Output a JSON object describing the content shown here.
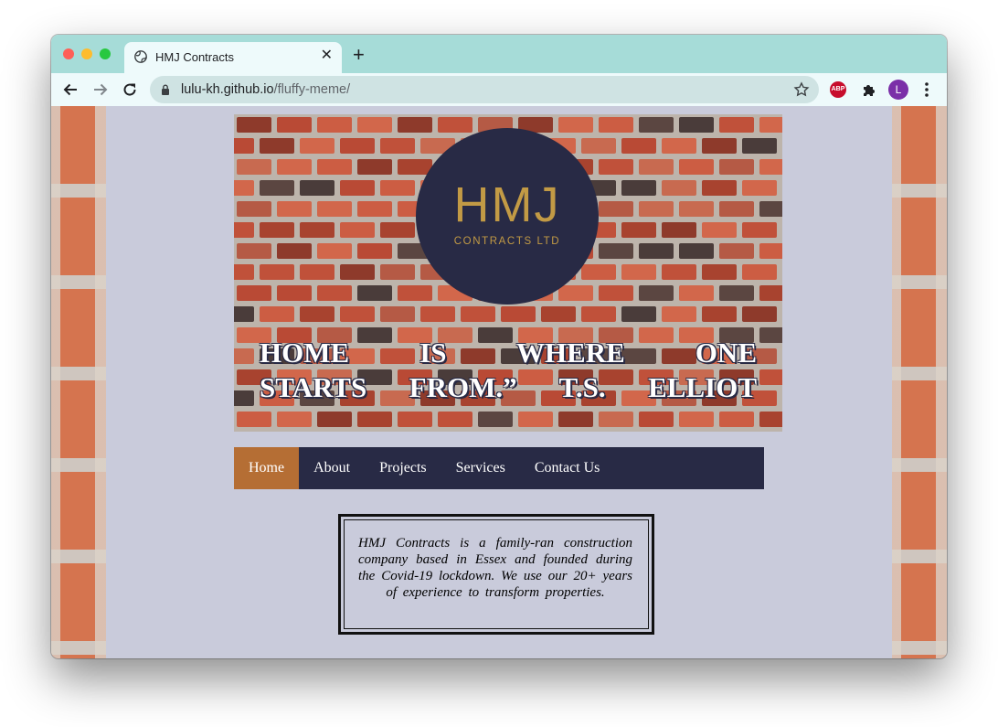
{
  "browser": {
    "tab_title": "HMJ Contracts",
    "url_host": "lulu-kh.github.io",
    "url_path": "/fluffy-meme/",
    "profile_initial": "L",
    "extension_abp": "ABP",
    "colors": {
      "tabstrip": "#a6dcd8",
      "toolbar": "#eefafb"
    }
  },
  "page": {
    "logo_main": "HMJ",
    "logo_sub": "CONTRACTS LTD",
    "quote_line1": "HOME IS WHERE ONE",
    "quote_line2": "STARTS FROM.” T.S. ELLIOT",
    "nav": [
      {
        "label": "Home",
        "active": true
      },
      {
        "label": "About",
        "active": false
      },
      {
        "label": "Projects",
        "active": false
      },
      {
        "label": "Services",
        "active": false
      },
      {
        "label": "Contact Us",
        "active": false
      }
    ],
    "intro": "HMJ Contracts is a family-ran construction company based in Essex and founded during the Covid-19 lockdown. We use our 20+ years of experience to transform properties.",
    "colors": {
      "navy": "#282a45",
      "accent": "#b56e34",
      "gold": "#c29a45",
      "background": "#c9cbdb"
    }
  }
}
